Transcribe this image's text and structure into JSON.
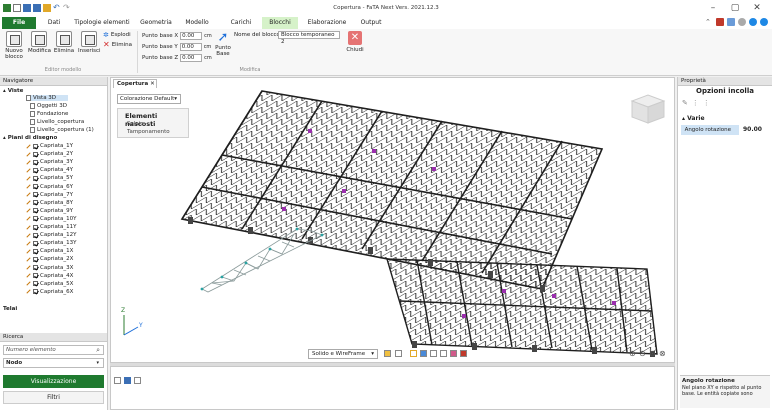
{
  "window": {
    "title": "Copertura - FaTA Next Vers. 2021.12.3"
  },
  "tabs": [
    {
      "label": "File"
    },
    {
      "label": "Dati"
    },
    {
      "label": "Tipologie elementi"
    },
    {
      "label": "Geometria"
    },
    {
      "label": "Modello"
    },
    {
      "label": "Carichi"
    },
    {
      "label": "Blocchi"
    },
    {
      "label": "Elaborazione"
    },
    {
      "label": "Output"
    }
  ],
  "ribbon": {
    "nuovo_blocco": "Nuovo blocco",
    "modifica": "Modifica",
    "elimina": "Elimina",
    "inserisci": "Inserisci",
    "esplodi": "Esplodi",
    "elimina_small": "Elimina",
    "group_editor": "Editor modello",
    "punto_x_label": "Punto base X",
    "punto_y_label": "Punto base Y",
    "punto_z_label": "Punto base Z",
    "punto_x": "0.00",
    "punto_y": "0.00",
    "punto_z": "0.00",
    "unit": "cm",
    "punto_base": "Punto Base",
    "nome_blocco_label": "Nome del blocco",
    "nome_blocco": "Blocco temporaneo 2",
    "chiudi": "Chiudi",
    "group_modifica": "Modifica"
  },
  "navigator": {
    "header": "Navigatore",
    "viste": "Viste",
    "vista3d": "Vista 3D",
    "oggetti3d": "Oggetti 3D",
    "fondazione": "Fondazione",
    "livello_copertura": "Livello_copertura",
    "livello_copertura1": "Livello_copertura (1)",
    "piani": "Piani di disegno",
    "capriate": [
      "Capriata_1Y",
      "Capriata_2Y",
      "Capriata_3Y",
      "Capriata_4Y",
      "Capriata_5Y",
      "Capriata_6Y",
      "Capriata_7Y",
      "Capriata_8Y",
      "Capriata_9Y",
      "Capriata_10Y",
      "Capriata_11Y",
      "Capriata_12Y",
      "Capriata_13Y",
      "Capriata_1X",
      "Capriata_2X",
      "Capriata_3X",
      "Capriata_4X",
      "Capriata_5X",
      "Capriata_6X"
    ],
    "telai": "Telai",
    "ricerca": "Ricerca",
    "numero_placeholder": "Numero elemento",
    "nodo": "Nodo",
    "visualizzazione": "Visualizzazione",
    "filtri": "Filtri"
  },
  "viewport": {
    "tab": "Copertura",
    "colorazione": "Colorazione Default",
    "hidden_title": "Elementi nascosti",
    "hidden_solaio": "Solaio",
    "hidden_tamponamento": "Tamponamento",
    "render_mode": "Solido e WireFrame"
  },
  "properties": {
    "header": "Proprietà",
    "title": "Opzioni incolla",
    "category": "Varie",
    "row_label": "Angolo rotazione",
    "row_value": "90.00",
    "desc_title": "Angolo rotazione",
    "desc_text": "Nel piano XY e rispetto al punto base. Le entità copiate sono"
  },
  "colors": {
    "accent": "#1f7a2f",
    "active_tab": "#d6f2c9",
    "steel": "#2b2b2b",
    "support": "#9b2fae"
  }
}
